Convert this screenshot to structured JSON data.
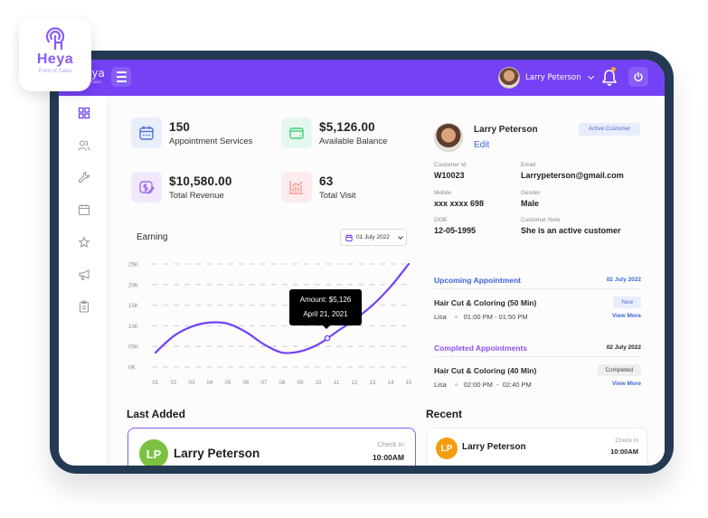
{
  "app": {
    "name": "Heya",
    "subtitle": "Point of Sales",
    "brand_color": "#7441f4"
  },
  "topbar": {
    "user_name": "Larry Peterson",
    "notification_dot_color": "#f5a524",
    "icons": [
      "menu-icon",
      "avatar",
      "chevron-down-icon",
      "bell-icon",
      "power-icon"
    ]
  },
  "sidebar": {
    "items": [
      {
        "name": "dashboard",
        "icon": "grid-icon",
        "active": true
      },
      {
        "name": "customers",
        "icon": "users-icon",
        "active": false
      },
      {
        "name": "services",
        "icon": "tools-icon",
        "active": false
      },
      {
        "name": "calendar",
        "icon": "calendar-icon",
        "active": false
      },
      {
        "name": "favorites",
        "icon": "star-icon",
        "active": false
      },
      {
        "name": "marketing",
        "icon": "megaphone-icon",
        "active": false
      },
      {
        "name": "reports",
        "icon": "clipboard-icon",
        "active": false
      }
    ]
  },
  "stats": [
    {
      "value": "150",
      "label": "Appointment Services",
      "icon": "calendar-icon",
      "color": "#4b6fe0",
      "bg": "#e9eefc"
    },
    {
      "value": "$5,126.00",
      "label": "Available Balance",
      "icon": "wallet-icon",
      "color": "#3fcf7f",
      "bg": "#e6f8ee"
    },
    {
      "value": "$10,580.00",
      "label": "Total Revenue",
      "icon": "revenue-icon",
      "color": "#a26af0",
      "bg": "#f1e8fd"
    },
    {
      "value": "63",
      "label": "Total Visit",
      "icon": "chart-icon",
      "color": "#f28a8a",
      "bg": "#fdecec"
    }
  ],
  "earning": {
    "title": "Earning",
    "date_filter": "01 July 2022",
    "tooltip": {
      "line1": "Amount: $5,126",
      "line2": "April 21, 2021"
    }
  },
  "chart_data": {
    "type": "line",
    "title": "Earning",
    "xlabel": "",
    "ylabel": "",
    "x": [
      "01",
      "02",
      "03",
      "04",
      "05",
      "06",
      "07",
      "08",
      "09",
      "10",
      "11",
      "12",
      "13",
      "14",
      "15"
    ],
    "y_ticks": [
      "0K",
      "05K",
      "10K",
      "15K",
      "20K",
      "25K"
    ],
    "ylim": [
      0,
      25000
    ],
    "grid": true,
    "series": [
      {
        "name": "Earning",
        "color": "#7441f4",
        "values": [
          3500,
          7500,
          9800,
          10800,
          10500,
          8500,
          5500,
          3500,
          3800,
          5500,
          8500,
          11500,
          15000,
          19500,
          25000
        ]
      }
    ],
    "highlight": {
      "x_index": 9.5,
      "value": 7000,
      "label": "Amount: $5,126",
      "date": "April 21, 2021"
    }
  },
  "customer": {
    "name": "Larry Peterson",
    "edit_label": "Edit",
    "status_badge": "Active Customer",
    "fields": [
      {
        "label": "Customer Id",
        "value": "W10023"
      },
      {
        "label": "Email",
        "value": "Larrypeterson@gmail.com"
      },
      {
        "label": "Mobile",
        "value": "xxx xxxx 698"
      },
      {
        "label": "Gender",
        "value": "Male"
      },
      {
        "label": "DOB",
        "value": "12-05-1995"
      },
      {
        "label": "Customer Note",
        "value": "She is an active customer"
      }
    ]
  },
  "upcoming": {
    "title": "Upcoming Appointment",
    "date": "02 July 2022",
    "service": "Hair Cut & Coloring (50 Min)",
    "status": "New",
    "staff": "Lisa",
    "time": "01:00 PM - 01:50 PM",
    "link": "View More"
  },
  "completed": {
    "title": "Completed Appointments",
    "date": "02 July 2022",
    "service": "Hair Cut & Coloring (40 Min)",
    "status": "Completed",
    "staff": "Lisa",
    "time": "02:00 PM  -  02:40 PM",
    "link": "View More"
  },
  "last_added": {
    "title": "Last Added",
    "initials": "LP",
    "name": "Larry Peterson",
    "checkin_label": "Check In",
    "checkin_time": "10:00AM",
    "avatar_color": "#7cc242"
  },
  "recent": {
    "title": "Recent",
    "initials": "LP",
    "name": "Larry Peterson",
    "checkin_label": "Check In",
    "checkin_time": "10:00AM",
    "avatar_color": "#f59d0e"
  }
}
